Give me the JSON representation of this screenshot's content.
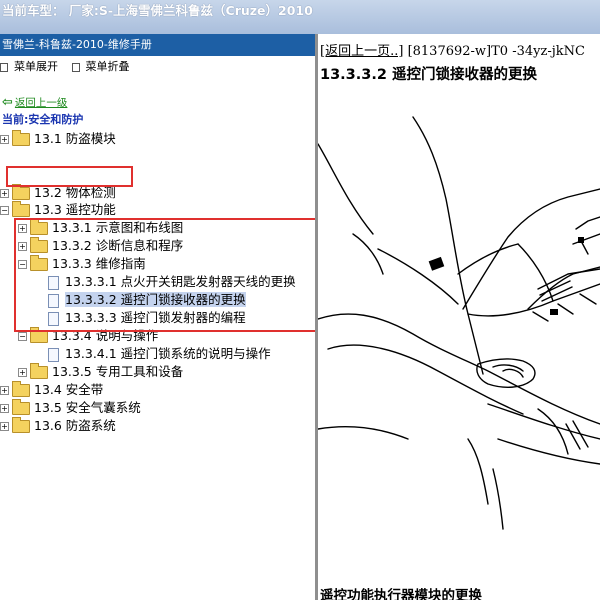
{
  "window": {
    "title": "当前车型：  厂家:S-上海雪佛兰科鲁兹（Cruze）2010"
  },
  "left": {
    "header": "雪佛兰-科鲁兹-2010-维修手册",
    "menu": [
      {
        "label": "菜单展开",
        "icon": "expand-icon"
      },
      {
        "label": "菜单折叠",
        "icon": "collapse-icon"
      }
    ],
    "back_link": "返回上一级",
    "current": "当前:安全和防护",
    "tree": [
      {
        "label": "13.1 防盗模块"
      },
      {
        "label": "13.2 物体检测"
      },
      {
        "label": "13.3 遥控功能"
      },
      {
        "label": "13.3.1 示意图和布线图"
      },
      {
        "label": "13.3.2 诊断信息和程序"
      },
      {
        "label": "13.3.3 维修指南"
      },
      {
        "label": "13.3.3.1 点火开关钥匙发射器天线的更换"
      },
      {
        "label": "13.3.3.2 遥控门锁接收器的更换"
      },
      {
        "label": "13.3.3.3 遥控门锁发射器的编程"
      },
      {
        "label": "13.3.4 说明与操作"
      },
      {
        "label": "13.3.4.1 遥控门锁系统的说明与操作"
      },
      {
        "label": "13.3.5 专用工具和设备"
      },
      {
        "label": "13.4 安全带"
      },
      {
        "label": "13.5 安全气囊系统"
      },
      {
        "label": "13.6 防盗系统"
      }
    ]
  },
  "right": {
    "back_link": "[返回上一页..]",
    "doc_ref": "[8137692-w]T0 -34yz-jkNC",
    "title": "13.3.3.2 遥控门锁接收器的更换",
    "next_section": "遥控功能执行器模块的更换"
  },
  "colors": {
    "header_blue": "#1d5fa5",
    "highlight": "#e0302e",
    "selected": "#c4d3ee",
    "back_green": "#1f8a1f",
    "current_blue": "#1a35b0"
  }
}
